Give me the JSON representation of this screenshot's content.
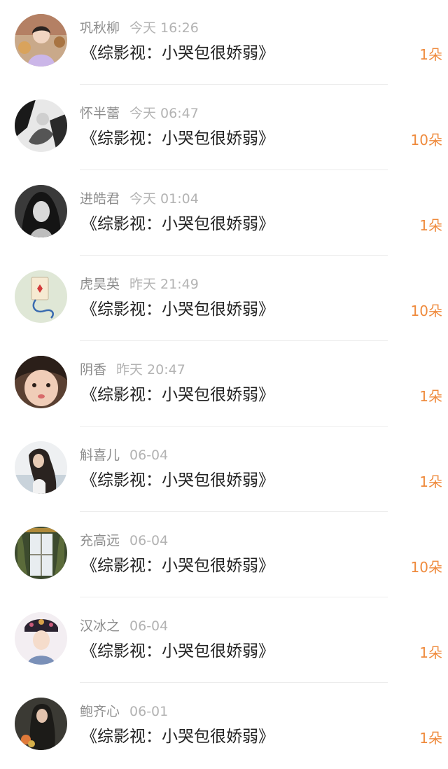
{
  "colors": {
    "name": "#8c8c8c",
    "time": "#b3b3b3",
    "title": "#222222",
    "gift": "#ef8a3c",
    "divider": "#ececec"
  },
  "items": [
    {
      "name": "巩秋柳",
      "time": "今天 16:26",
      "title": "《综影视：小哭包很娇弱》",
      "gift": "1朵",
      "avatar": "avatar-person-purple-hoodie"
    },
    {
      "name": "怀半蕾",
      "time": "今天 06:47",
      "title": "《综影视：小哭包很娇弱》",
      "gift": "10朵",
      "avatar": "avatar-black-white-abstract"
    },
    {
      "name": "进皓君",
      "time": "今天 01:04",
      "title": "《综影视：小哭包很娇弱》",
      "gift": "1朵",
      "avatar": "avatar-monochrome-portrait"
    },
    {
      "name": "虎昊英",
      "time": "昨天 21:49",
      "title": "《综影视：小哭包很娇弱》",
      "gift": "10朵",
      "avatar": "avatar-playing-card"
    },
    {
      "name": "阴香",
      "time": "昨天 20:47",
      "title": "《综影视：小哭包很娇弱》",
      "gift": "1朵",
      "avatar": "avatar-girl-closeup"
    },
    {
      "name": "斛喜儿",
      "time": "06-04",
      "title": "《综影视：小哭包很娇弱》",
      "gift": "1朵",
      "avatar": "avatar-girl-long-hair"
    },
    {
      "name": "充高远",
      "time": "06-04",
      "title": "《综影视：小哭包很娇弱》",
      "gift": "10朵",
      "avatar": "avatar-window-curtains"
    },
    {
      "name": "汉冰之",
      "time": "06-04",
      "title": "《综影视：小哭包很娇弱》",
      "gift": "1朵",
      "avatar": "avatar-qing-costume"
    },
    {
      "name": "鲍齐心",
      "time": "06-01",
      "title": "《综影视：小哭包很娇弱》",
      "gift": "1朵",
      "avatar": "avatar-girl-flowers"
    }
  ]
}
